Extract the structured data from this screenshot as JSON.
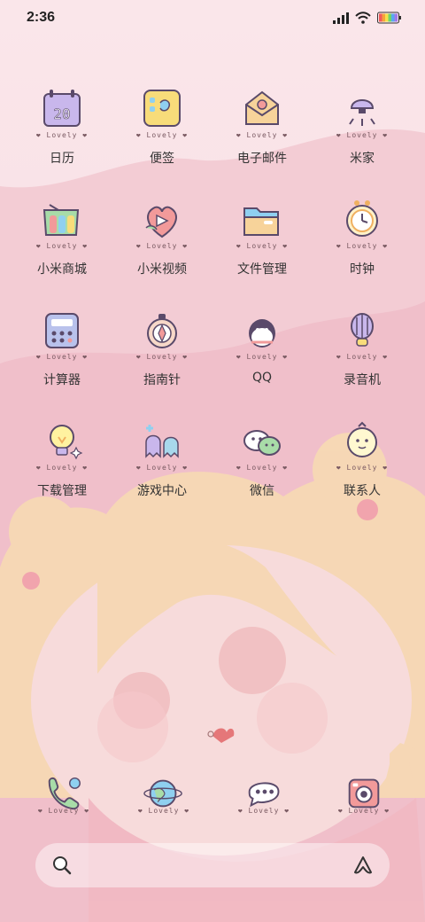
{
  "status_bar": {
    "time": "2:36",
    "icons": [
      "signal-icon",
      "wifi-icon",
      "battery-icon"
    ]
  },
  "lovely_tag": "Lovely",
  "apps": [
    {
      "label": "日历",
      "icon": "calendar-icon",
      "icon_text": "20"
    },
    {
      "label": "便签",
      "icon": "notes-icon"
    },
    {
      "label": "电子邮件",
      "icon": "email-icon"
    },
    {
      "label": "米家",
      "icon": "mijia-icon"
    },
    {
      "label": "小米商城",
      "icon": "mi-store-icon"
    },
    {
      "label": "小米视频",
      "icon": "mi-video-icon"
    },
    {
      "label": "文件管理",
      "icon": "file-manager-icon"
    },
    {
      "label": "时钟",
      "icon": "clock-icon"
    },
    {
      "label": "计算器",
      "icon": "calculator-icon"
    },
    {
      "label": "指南针",
      "icon": "compass-icon"
    },
    {
      "label": "QQ",
      "icon": "qq-icon"
    },
    {
      "label": "录音机",
      "icon": "recorder-icon"
    },
    {
      "label": "下载管理",
      "icon": "download-manager-icon"
    },
    {
      "label": "游戏中心",
      "icon": "game-center-icon"
    },
    {
      "label": "微信",
      "icon": "wechat-icon"
    },
    {
      "label": "联系人",
      "icon": "contacts-icon"
    }
  ],
  "dock": [
    {
      "icon": "phone-icon"
    },
    {
      "icon": "browser-icon"
    },
    {
      "icon": "messages-icon"
    },
    {
      "icon": "camera-icon"
    }
  ],
  "search_bar": {
    "left_icon": "search-icon",
    "right_icon": "assistant-icon"
  },
  "colors": {
    "background_top": "#f9e3e7",
    "background_mid": "#f3c5cf",
    "background_bottom": "#f6d3da",
    "hair": "#f8dcb2"
  }
}
